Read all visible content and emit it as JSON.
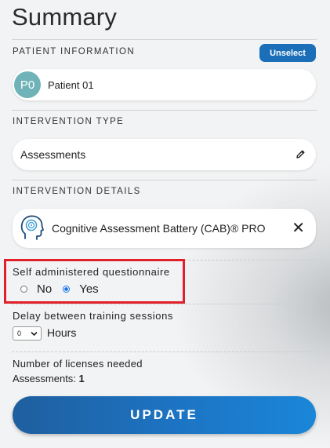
{
  "page": {
    "title": "Summary"
  },
  "patient": {
    "section_label": "PATIENT INFORMATION",
    "unselect_label": "Unselect",
    "avatar_initials": "P0",
    "name": "Patient 01"
  },
  "intervention_type": {
    "section_label": "INTERVENTION TYPE",
    "value": "Assessments",
    "icon": "pencil-icon"
  },
  "intervention_details": {
    "section_label": "INTERVENTION DETAILS",
    "item_name": "Cognitive Assessment Battery (CAB)® PRO",
    "item_icon": "head-brain-icon",
    "remove_symbol": "✕"
  },
  "self_administered": {
    "label": "Self administered questionnaire",
    "options": [
      {
        "label": "No",
        "selected": false
      },
      {
        "label": "Yes",
        "selected": true
      }
    ],
    "highlight_color": "#e0202a"
  },
  "delay": {
    "label": "Delay between training sessions",
    "selected_value": "0",
    "unit": "Hours"
  },
  "licenses": {
    "label": "Number of licenses needed",
    "line_prefix": "Assessments:",
    "count": "1"
  },
  "actions": {
    "update_label": "UPDATE"
  },
  "colors": {
    "accent": "#1b6fb8",
    "avatar_bg": "#6fb3b8"
  }
}
